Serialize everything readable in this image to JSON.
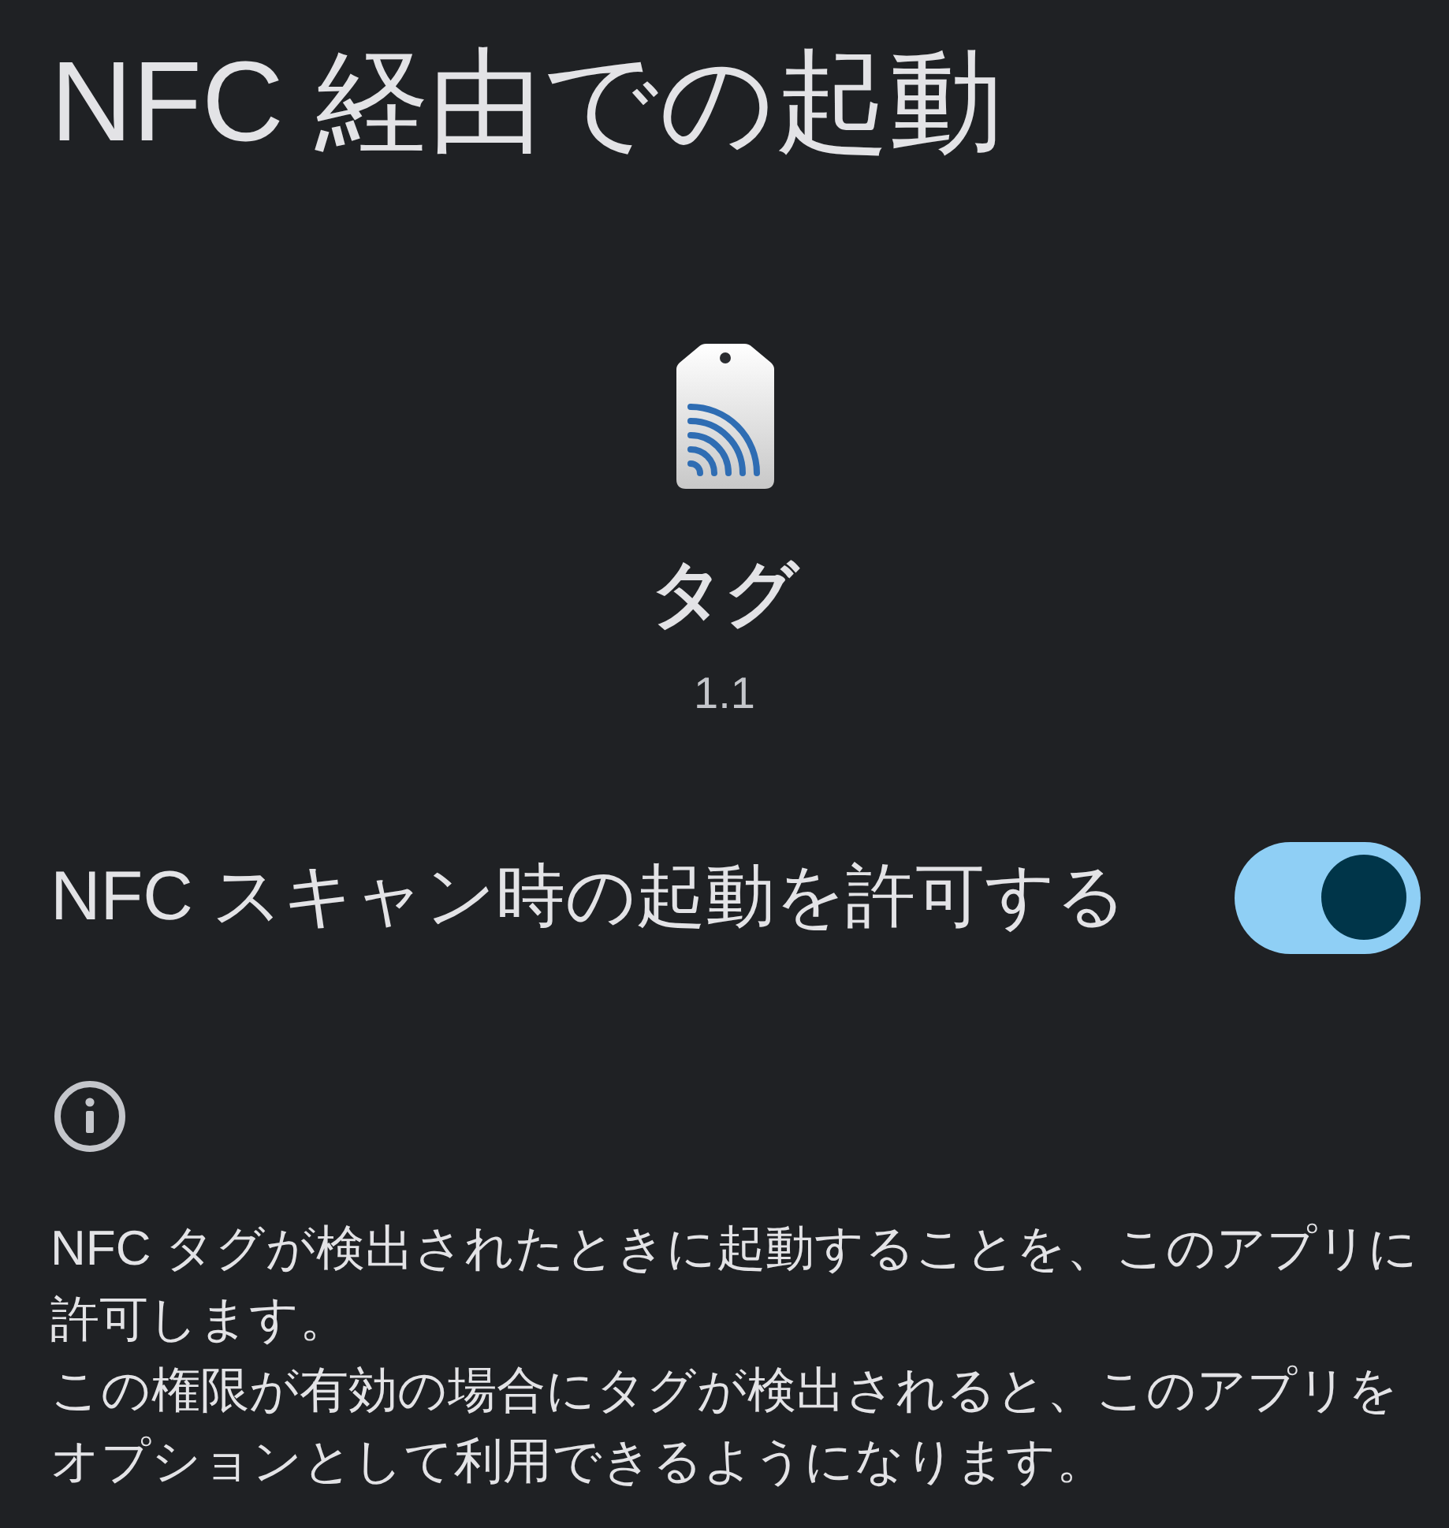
{
  "title": "NFC 経由での起動",
  "app": {
    "name": "タグ",
    "version": "1.1"
  },
  "setting": {
    "label": "NFC スキャン時の起動を許可する",
    "on": true
  },
  "description": [
    "NFC タグが検出されたときに起動することを、このアプリに許可します。",
    "この権限が有効の場合にタグが検出されると、このアプリをオプションとして利用できるようになります。"
  ]
}
